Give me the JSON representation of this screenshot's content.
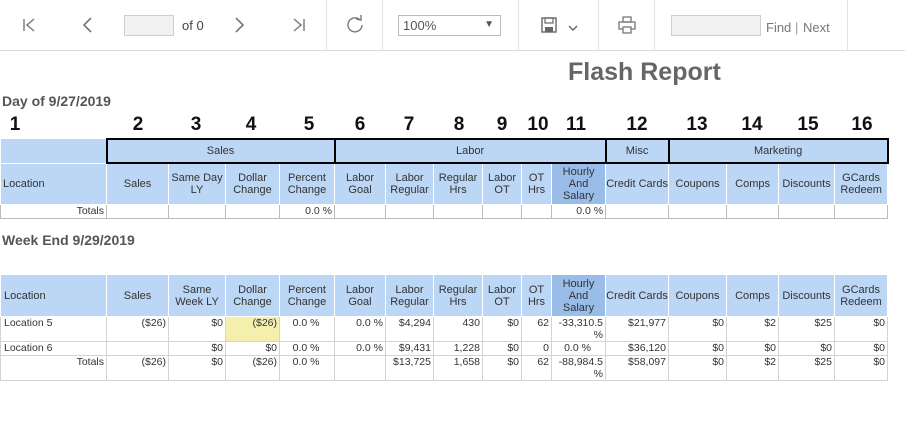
{
  "toolbar": {
    "page_value": "",
    "of_text": "of 0",
    "zoom": "100%",
    "find_placeholder": "",
    "find_label": "Find",
    "separator": "|",
    "next_label": "Next"
  },
  "report": {
    "title": "Flash Report",
    "day_section": "Day of 9/27/2019",
    "week_section": "Week End 9/29/2019",
    "column_numbers": [
      "1",
      "2",
      "3",
      "4",
      "5",
      "6",
      "7",
      "8",
      "9",
      "10",
      "11",
      "12",
      "13",
      "14",
      "15",
      "16"
    ],
    "groups": {
      "sales": "Sales",
      "labor": "Labor",
      "misc": "Misc",
      "marketing": "Marketing"
    },
    "day_headers": {
      "location": "Location",
      "sales": "Sales",
      "same_day_ly": "Same Day LY",
      "dollar_change": "Dollar Change",
      "percent_change": "Percent Change",
      "labor_goal": "Labor Goal",
      "labor_regular": "Labor Regular",
      "regular_hrs": "Regular Hrs",
      "labor_ot": "Labor OT",
      "ot_hrs": "OT Hrs",
      "hourly_salary": "Hourly And Salary",
      "credit_cards": "Credit Cards",
      "coupons": "Coupons",
      "comps": "Comps",
      "discounts": "Discounts",
      "gcards": "GCards Redeem"
    },
    "day_totals": {
      "label": "Totals",
      "percent_change": "0.0 %",
      "hourly_salary": "0.0 %"
    },
    "week_headers": {
      "location": "Location",
      "sales": "Sales",
      "same_week_ly": "Same Week LY",
      "dollar_change": "Dollar Change",
      "percent_change": "Percent Change",
      "labor_goal": "Labor Goal",
      "labor_regular": "Labor Regular",
      "regular_hrs": "Regular Hrs",
      "labor_ot": "Labor OT",
      "ot_hrs": "OT Hrs",
      "hourly_salary": "Hourly And Salary",
      "credit_cards": "Credit Cards",
      "coupons": "Coupons",
      "comps": "Comps",
      "discounts": "Discounts",
      "gcards": "GCards Redeem"
    },
    "week_rows": [
      {
        "location": "Location 5",
        "sales": "($26)",
        "same_week_ly": "$0",
        "dollar_change": "($26)",
        "percent_change": "0.0 %",
        "labor_goal": "0.0 %",
        "labor_regular": "$4,294",
        "regular_hrs": "430",
        "labor_ot": "$0",
        "ot_hrs": "62",
        "hourly_salary": "-33,310.5 %",
        "credit_cards": "$21,977",
        "coupons": "$0",
        "comps": "$2",
        "discounts": "$25",
        "gcards": "$0"
      },
      {
        "location": "Location 6",
        "sales": "",
        "same_week_ly": "$0",
        "dollar_change": "$0",
        "percent_change": "0.0 %",
        "labor_goal": "0.0 %",
        "labor_regular": "$9,431",
        "regular_hrs": "1,228",
        "labor_ot": "$0",
        "ot_hrs": "0",
        "hourly_salary": "0.0 %",
        "credit_cards": "$36,120",
        "coupons": "$0",
        "comps": "$0",
        "discounts": "$0",
        "gcards": "$0"
      }
    ],
    "week_totals": {
      "label": "Totals",
      "sales": "($26)",
      "same_week_ly": "$0",
      "dollar_change": "($26)",
      "percent_change": "0.0 %",
      "labor_goal": "",
      "labor_regular": "$13,725",
      "regular_hrs": "1,658",
      "labor_ot": "$0",
      "ot_hrs": "62",
      "hourly_salary": "-88,984.5 %",
      "credit_cards": "$58,097",
      "coupons": "$0",
      "comps": "$2",
      "discounts": "$25",
      "gcards": "$0"
    }
  }
}
